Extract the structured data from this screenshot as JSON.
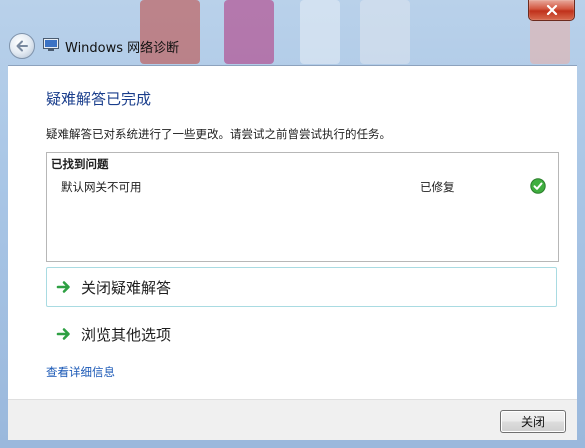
{
  "window": {
    "title": "Windows 网络诊断"
  },
  "page": {
    "heading": "疑难解答已完成",
    "description": "疑难解答已对系统进行了一些更改。请尝试之前曾尝试执行的任务。"
  },
  "problems": {
    "header": "已找到问题",
    "items": [
      {
        "issue": "默认网关不可用",
        "status": "已修复",
        "icon": "green-check-icon"
      }
    ]
  },
  "actions": [
    {
      "label": "关闭疑难解答",
      "icon": "green-arrow-icon"
    },
    {
      "label": "浏览其他选项",
      "icon": "green-arrow-icon"
    }
  ],
  "links": {
    "details": "查看详细信息"
  },
  "footer": {
    "close_button": "关闭"
  },
  "colors": {
    "heading": "#1a3e8c",
    "link": "#1a58b6",
    "accent_green": "#2ea043",
    "action_border": "#a9dbe2"
  }
}
